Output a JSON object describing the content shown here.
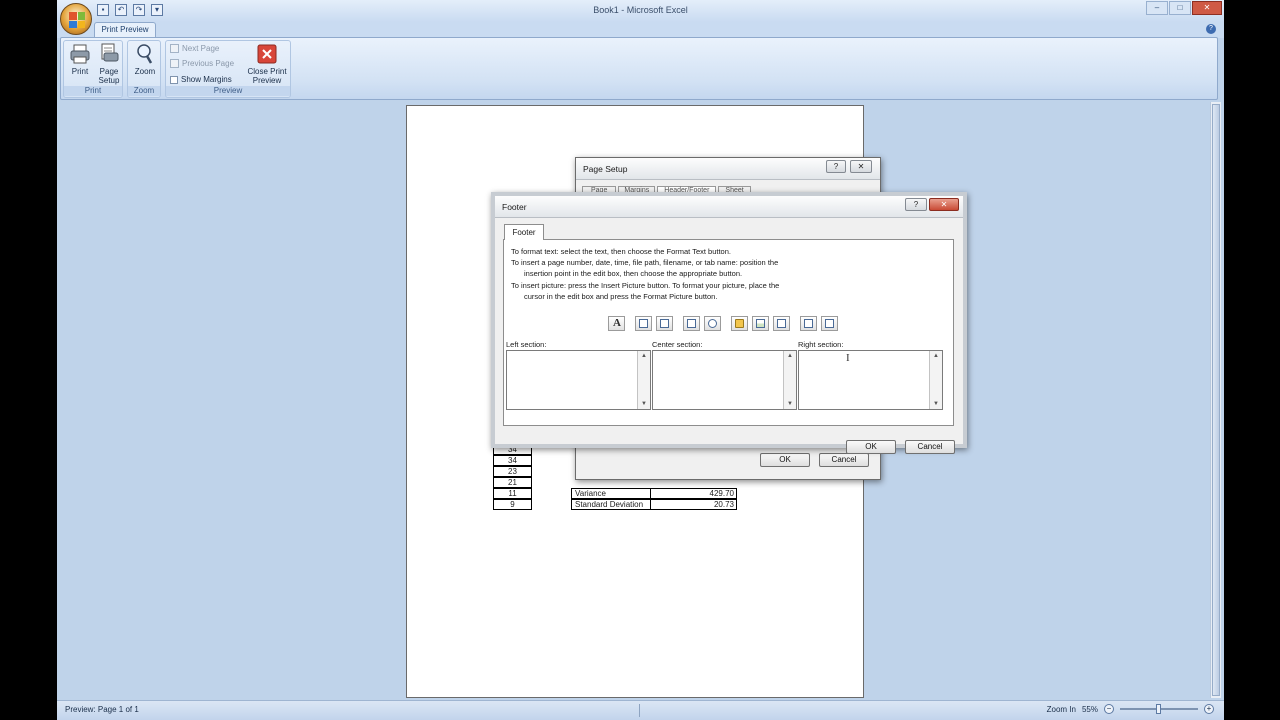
{
  "window": {
    "title": "Book1 - Microsoft Excel",
    "controls": {
      "minimize": "–",
      "maximize": "□",
      "close": "✕"
    }
  },
  "ribbon": {
    "active_tab": "Print Preview",
    "groups": {
      "print": {
        "label": "Print",
        "print_btn": "Print",
        "page_setup_btn_1": "Page",
        "page_setup_btn_2": "Setup"
      },
      "zoom": {
        "label": "Zoom",
        "zoom_btn": "Zoom"
      },
      "preview": {
        "label": "Preview",
        "next_page": "Next Page",
        "previous_page": "Previous Page",
        "show_margins": "Show Margins",
        "close_preview_1": "Close Print",
        "close_preview_2": "Preview"
      }
    }
  },
  "sheet": {
    "left_column": [
      "34",
      "34",
      "23",
      "21",
      "11",
      "9"
    ],
    "stats": [
      {
        "label": "Variance",
        "value": "429.70"
      },
      {
        "label": "Standard Deviation",
        "value": "20.73"
      }
    ]
  },
  "page_setup_dialog": {
    "title": "Page Setup",
    "help": "?",
    "close": "✕",
    "tabs": [
      "Page",
      "Margins",
      "Header/Footer",
      "Sheet"
    ],
    "ok": "OK",
    "cancel": "Cancel"
  },
  "footer_dialog": {
    "title": "Footer",
    "help": "?",
    "close": "✕",
    "tab": "Footer",
    "instructions": [
      "To format text:  select the text, then choose the Format Text button.",
      "To insert a page number, date, time, file path, filename, or tab name:  position the",
      "insertion point in the edit box, then choose the appropriate button.",
      "To insert picture: press the Insert Picture button.  To format your picture, place the",
      "cursor in the edit box and press the Format Picture button."
    ],
    "sections": {
      "left": "Left section:",
      "center": "Center section:",
      "right": "Right section:"
    },
    "left_value": "",
    "center_value": "",
    "right_value": "",
    "ok": "OK",
    "cancel": "Cancel"
  },
  "status": {
    "text": "Preview: Page 1 of 1",
    "zoom_in": "Zoom In",
    "zoom_level": "55%",
    "minus": "−",
    "plus": "+"
  },
  "colors": {
    "workspace": "#bfd3ea",
    "ribbon": "#d3e2f4",
    "dialog_bg": "#f0f0f0",
    "close_red": "#c94a35"
  }
}
